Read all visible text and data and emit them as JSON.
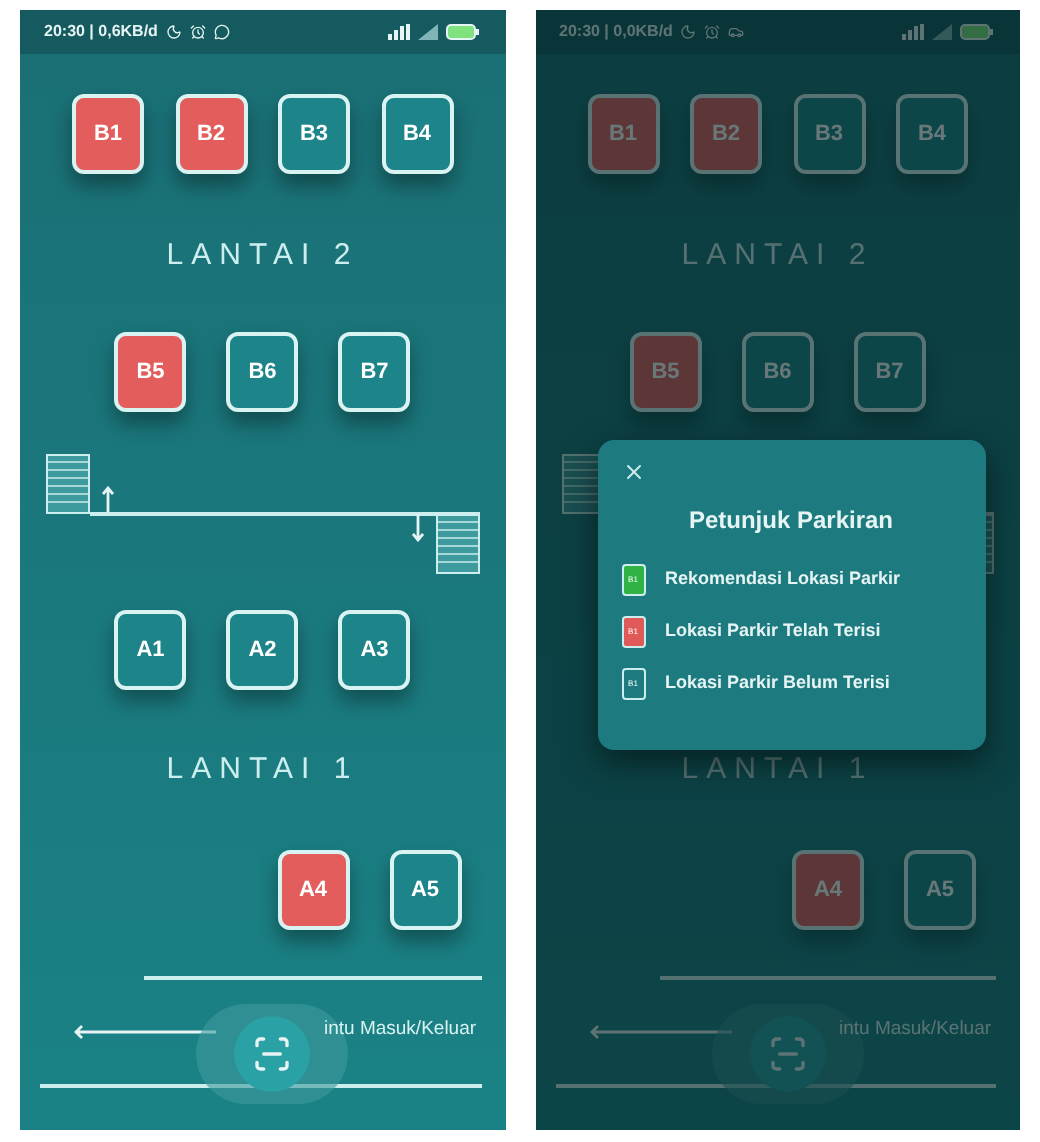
{
  "screens": [
    {
      "dimmed": false,
      "status_bar": {
        "time": "20:30 | 0,6KB/d"
      },
      "sections": [
        {
          "kind": "slots",
          "slots": [
            {
              "label": "B1",
              "occupied": true
            },
            {
              "label": "B2",
              "occupied": true
            },
            {
              "label": "B3",
              "occupied": false
            },
            {
              "label": "B4",
              "occupied": false
            }
          ]
        },
        {
          "kind": "floor",
          "label": "LANTAI 2"
        },
        {
          "kind": "slots",
          "slots": [
            {
              "label": "B5",
              "occupied": true
            },
            {
              "label": "B6",
              "occupied": false
            },
            {
              "label": "B7",
              "occupied": false
            }
          ]
        },
        {
          "kind": "stairs"
        },
        {
          "kind": "slots",
          "slots": [
            {
              "label": "A1",
              "occupied": false
            },
            {
              "label": "A2",
              "occupied": false
            },
            {
              "label": "A3",
              "occupied": false
            }
          ]
        },
        {
          "kind": "floor",
          "label": "LANTAI 1"
        },
        {
          "kind": "slots",
          "slots": [
            {
              "label": "A4",
              "occupied": true
            },
            {
              "label": "A5",
              "occupied": false
            }
          ]
        }
      ],
      "bottom": {
        "label": "intu Masuk/Keluar"
      }
    },
    {
      "dimmed": true,
      "status_bar": {
        "time": "20:30 | 0,0KB/d"
      },
      "sections": [
        {
          "kind": "slots",
          "slots": [
            {
              "label": "B1",
              "occupied": true
            },
            {
              "label": "B2",
              "occupied": true
            },
            {
              "label": "B3",
              "occupied": false
            },
            {
              "label": "B4",
              "occupied": false
            }
          ]
        },
        {
          "kind": "floor",
          "label": "LANTAI 2"
        },
        {
          "kind": "slots",
          "slots": [
            {
              "label": "B5",
              "occupied": true
            },
            {
              "label": "B6",
              "occupied": false
            },
            {
              "label": "B7",
              "occupied": false
            }
          ]
        },
        {
          "kind": "stairs"
        },
        {
          "kind": "slots"
        },
        {
          "kind": "floor",
          "label": "LANTAI 1"
        },
        {
          "kind": "slots",
          "slots": [
            {
              "label": "A4",
              "occupied": true
            },
            {
              "label": "A5",
              "occupied": false
            }
          ]
        }
      ],
      "bottom": {
        "label": "intu Masuk/Keluar"
      },
      "dialog": {
        "title": "Petunjuk Parkiran",
        "items": [
          {
            "marker": "B1",
            "color": "#2fb344",
            "label": "Rekomendasi Lokasi Parkir"
          },
          {
            "marker": "B1",
            "color": "#e05a5a",
            "label": "Lokasi Parkir Telah Terisi"
          },
          {
            "marker": "B1",
            "color": "#1d7b80",
            "label": "Lokasi Parkir Belum Terisi"
          }
        ]
      }
    }
  ]
}
